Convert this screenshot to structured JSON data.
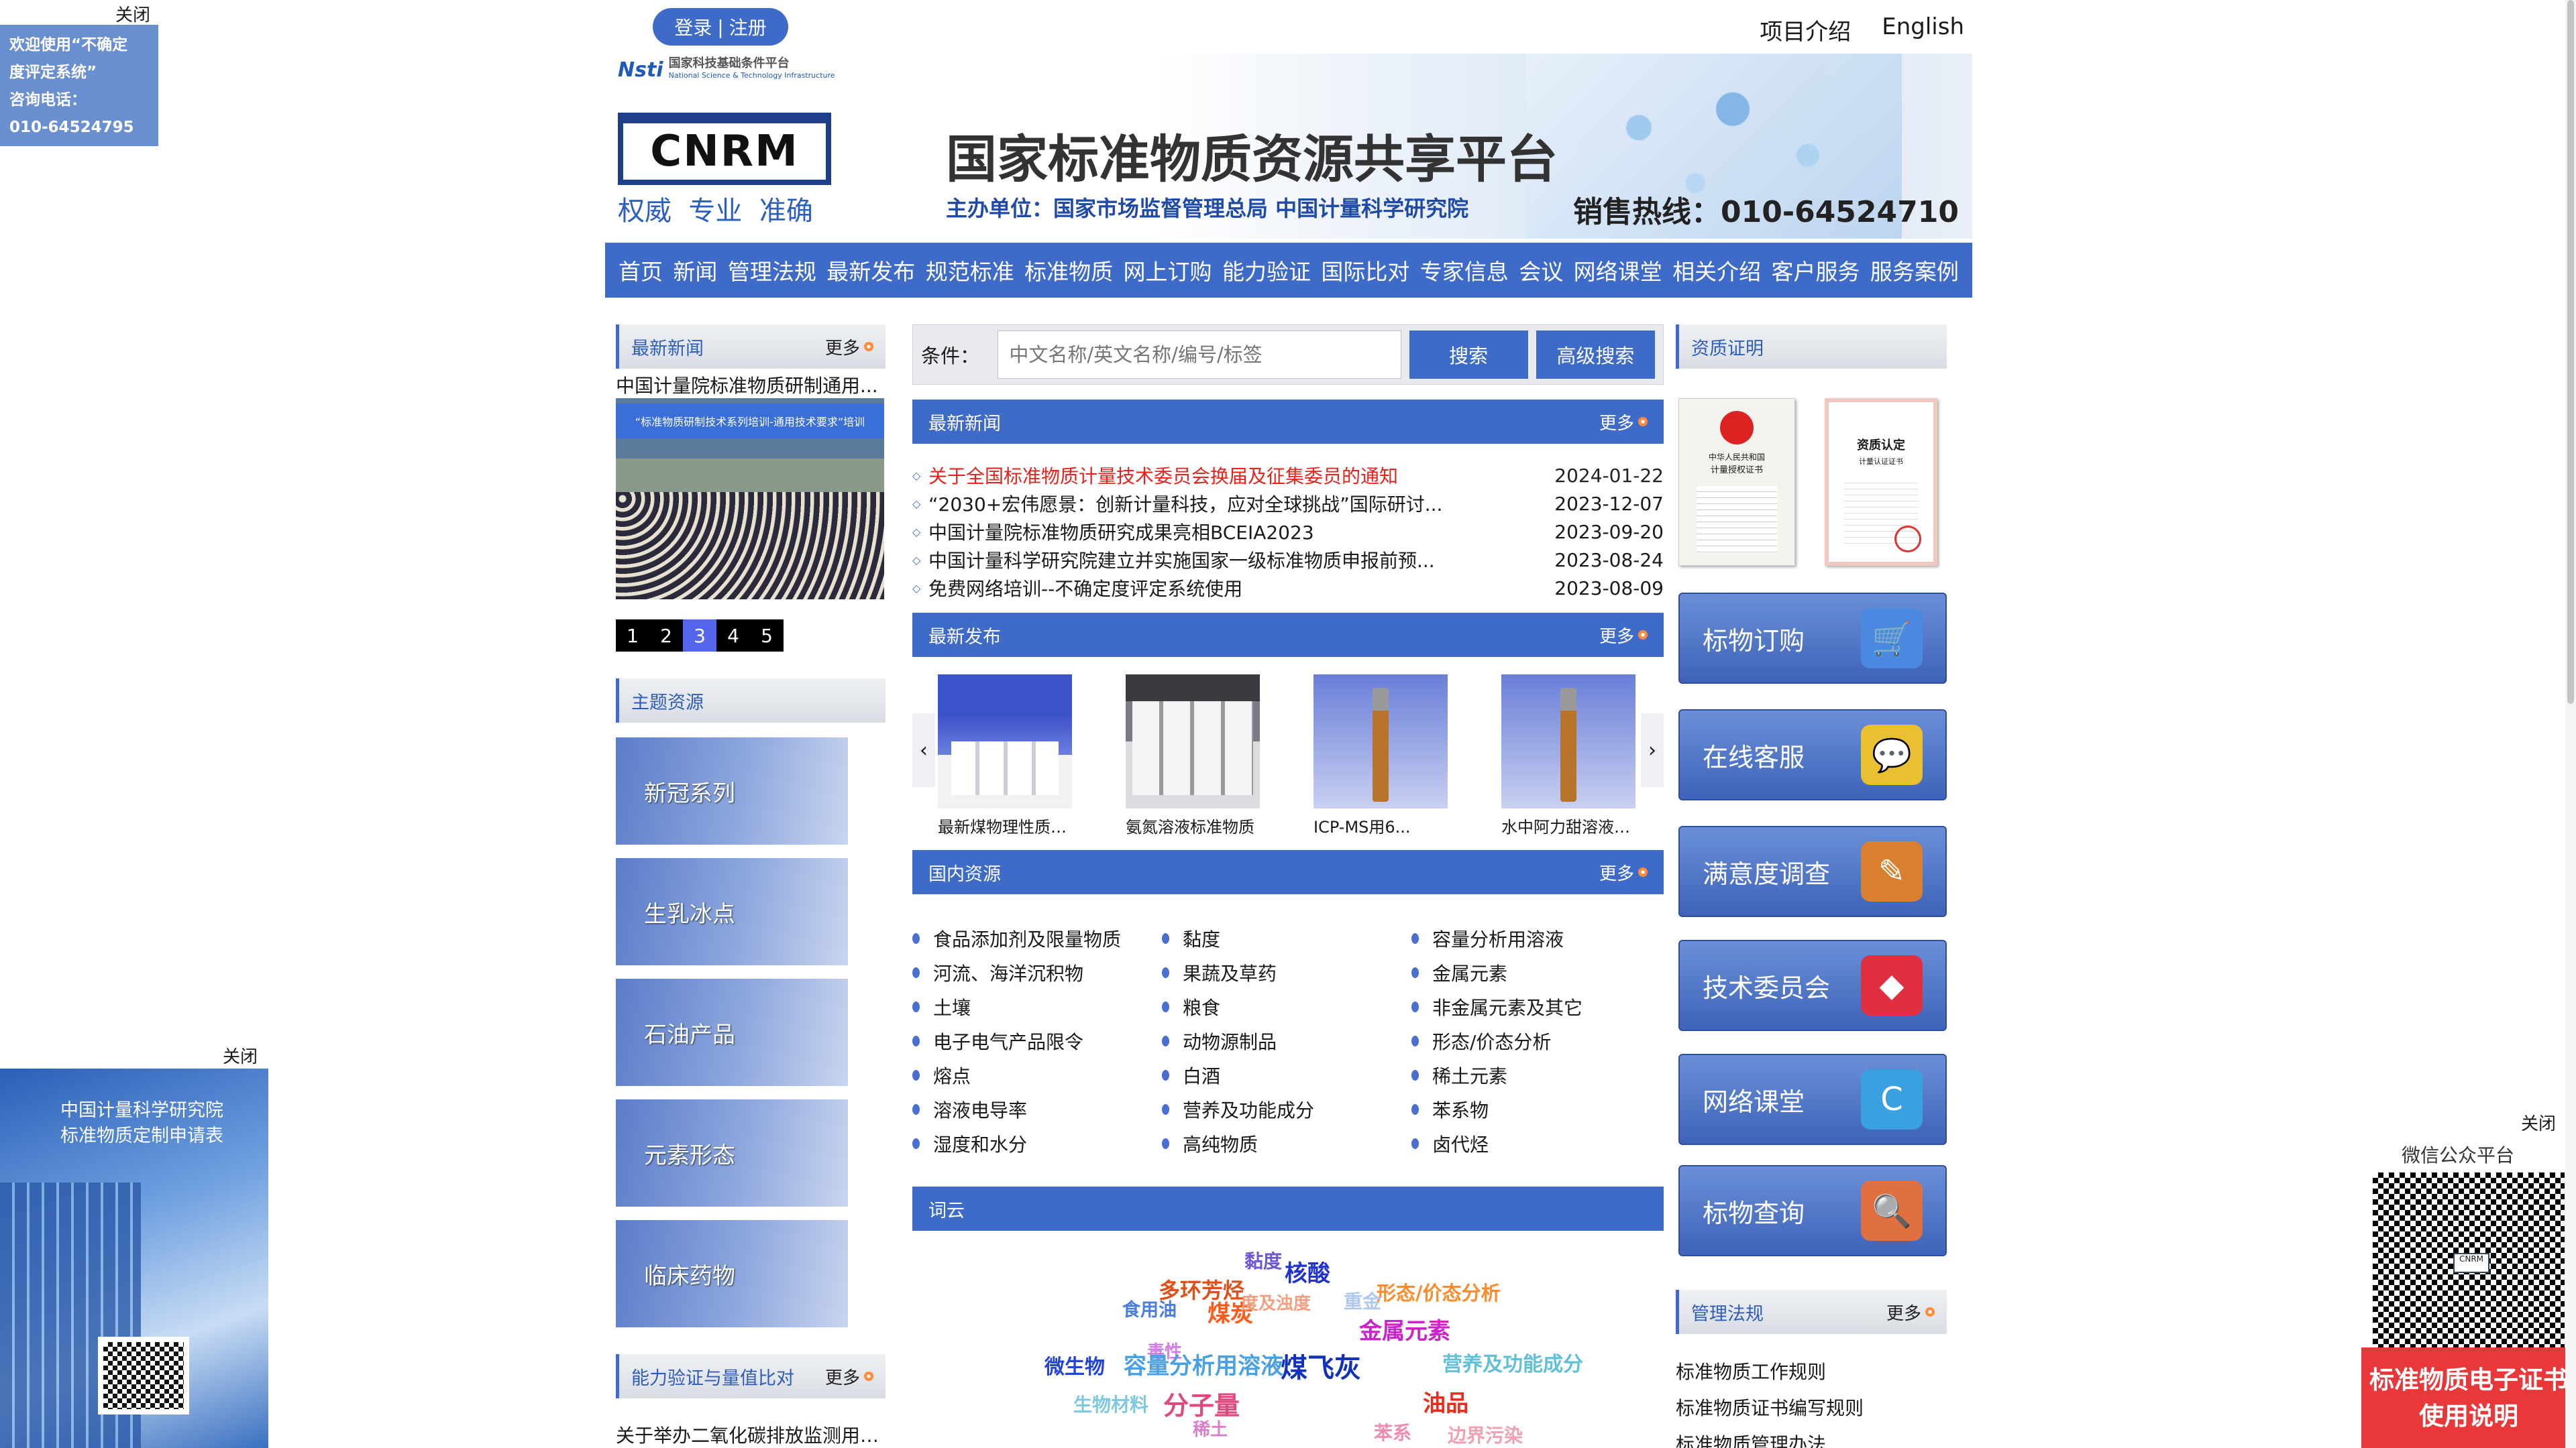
{
  "float_left_top": {
    "close": "关闭",
    "lines": [
      "欢迎使用“不确定",
      "度评定系统”",
      "咨询电话：",
      "010-64524795"
    ]
  },
  "float_left_mid": {
    "close": "关闭",
    "text1": "中国计量科学研究院",
    "text2": "标准物质定制申请表"
  },
  "float_right": {
    "close": "关闭",
    "title": "微信公众平台",
    "banner1": "标准物质电子证书",
    "banner2": "使用说明"
  },
  "header": {
    "login": "登录",
    "register": "注册",
    "links": [
      "项目介绍",
      "English"
    ],
    "nsti_brand": "Nsti",
    "nsti_cn": "国家科技基础条件平台",
    "nsti_en": "National Science & Technology Infrastructure",
    "logo": "CNRM",
    "slogan": "权威  专业  准确",
    "title": "国家标准物质资源共享平台",
    "host": "主办单位：国家市场监督管理总局 中国计量科学研究院",
    "hotline": "销售热线：010-64524710"
  },
  "nav": [
    "首页",
    "新闻",
    "管理法规",
    "最新发布",
    "规范标准",
    "标准物质",
    "网上订购",
    "能力验证",
    "国际比对",
    "专家信息",
    "会议",
    "网络课堂",
    "相关介绍",
    "客户服务",
    "服务案例"
  ],
  "left": {
    "news_title": "最新新闻",
    "more": "更多",
    "news_headline": "中国计量院标准物质研制通用...",
    "photo_caption": "“标准物质研制技术系列培训-通用技术要求”培训",
    "pages": [
      "1",
      "2",
      "3",
      "4",
      "5"
    ],
    "active_page": "3",
    "themes_title": "主题资源",
    "themes": [
      "新冠系列",
      "生乳冰点",
      "石油产品",
      "元素形态",
      "临床药物"
    ],
    "pt_title": "能力验证与量值比对",
    "pt_item": "关于举办二氧化碳排放监测用标..."
  },
  "search": {
    "label": "条件：",
    "placeholder": "中文名称/英文名称/编号/标签",
    "button": "搜索",
    "advanced": "高级搜索"
  },
  "news": {
    "title": "最新新闻",
    "more": "更多",
    "items": [
      {
        "text": "关于全国标准物质计量技术委员会换届及征集委员的通知",
        "date": "2024-01-22",
        "highlight": true
      },
      {
        "text": "“2030+宏伟愿景：创新计量科技，应对全球挑战”国际研讨...",
        "date": "2023-12-07",
        "highlight": false
      },
      {
        "text": "中国计量院标准物质研究成果亮相BCEIA2023",
        "date": "2023-09-20",
        "highlight": false
      },
      {
        "text": "中国计量科学研究院建立并实施国家一级标准物质申报前预...",
        "date": "2023-08-24",
        "highlight": false
      },
      {
        "text": "免费网络培训--不确定度评定系统使用",
        "date": "2023-08-09",
        "highlight": false
      }
    ]
  },
  "releases": {
    "title": "最新发布",
    "more": "更多",
    "items": [
      "最新煤物理性质和...",
      "氨氮溶液标准物质",
      "ICP-MS用6...",
      "水中阿力甜溶液标..."
    ]
  },
  "domestic": {
    "title": "国内资源",
    "more": "更多",
    "col1": [
      "食品添加剂及限量物质",
      "河流、海洋沉积物",
      "土壤",
      "电子电气产品限令",
      "熔点",
      "溶液电导率",
      "湿度和水分"
    ],
    "col2": [
      "黏度",
      "果蔬及草药",
      "粮食",
      "动物源制品",
      "白酒",
      "营养及功能成分",
      "高纯物质"
    ],
    "col3": [
      "容量分析用溶液",
      "金属元素",
      "非金属元素及其它",
      "形态/价态分析",
      "稀土元素",
      "苯系物",
      "卤代烃"
    ]
  },
  "wordcloud": {
    "title": "词云",
    "words": [
      {
        "t": "黏度",
        "c": "#6a5acd"
      },
      {
        "t": "核酸",
        "c": "#2233cc"
      },
      {
        "t": "多环芳烃",
        "c": "#e0501a"
      },
      {
        "t": "形态/价态分析",
        "c": "#ff8a2a"
      },
      {
        "t": "食用油",
        "c": "#4a7de0"
      },
      {
        "t": "煤炭",
        "c": "#ff5a1a"
      },
      {
        "t": "度及浊度",
        "c": "#f2a080"
      },
      {
        "t": "重金",
        "c": "#b0c8f0"
      },
      {
        "t": "金属元素",
        "c": "#cc22cc"
      },
      {
        "t": "毒性",
        "c": "#d080e0"
      },
      {
        "t": "微生物",
        "c": "#2244dd"
      },
      {
        "t": "容量分析用溶液",
        "c": "#4aa0e0"
      },
      {
        "t": "煤飞灰",
        "c": "#1133bb"
      },
      {
        "t": "营养及功能成分",
        "c": "#60c0d8"
      },
      {
        "t": "生物材料",
        "c": "#80c8e0"
      },
      {
        "t": "分子量",
        "c": "#e04880"
      },
      {
        "t": "油品",
        "c": "#ee2a1a"
      },
      {
        "t": "稀土",
        "c": "#d880c8"
      },
      {
        "t": "苯系",
        "c": "#f08ab0"
      },
      {
        "t": "边界污染",
        "c": "#f0a0b0"
      }
    ]
  },
  "right": {
    "qual_title": "资质证明",
    "cert1_a": "中华人民共和国",
    "cert1_b": "计量授权证书",
    "cert2_a": "资质认定",
    "cert2_b": "计量认证证书",
    "services": [
      "标物订购",
      "在线客服",
      "满意度调查",
      "技术委员会",
      "网络课堂",
      "标物查询"
    ],
    "colors": [
      "#4a8ae0",
      "#e8c030",
      "#d88030",
      "#e03040",
      "#3aa0e0",
      "#e07040"
    ],
    "icons": [
      "🛒",
      "💬",
      "✎",
      "◆",
      "C",
      "🔍"
    ],
    "law_title": "管理法规",
    "more": "更多",
    "laws": [
      "标准物质工作规则",
      "标准物质证书编写规则",
      "标准物质管理办法"
    ]
  }
}
